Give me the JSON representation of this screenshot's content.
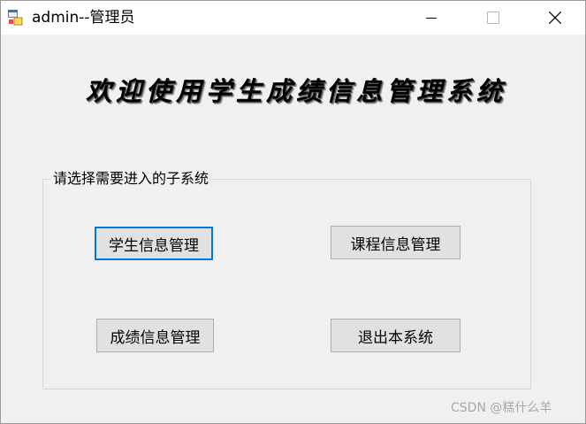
{
  "window": {
    "title": "admin--管理员",
    "icon": "windows-form-icon",
    "controls": {
      "minimize": "minimize-icon",
      "maximize": "maximize-icon",
      "close": "close-icon"
    }
  },
  "banner": {
    "text": "欢迎使用学生成绩信息管理系统"
  },
  "group": {
    "legend": "请选择需要进入的子系统",
    "buttons": {
      "student": "学生信息管理",
      "course": "课程信息管理",
      "score": "成绩信息管理",
      "exit": "退出本系统"
    }
  },
  "watermark": "CSDN @糕什么羊",
  "colors": {
    "focus_border": "#0078d7",
    "button_bg": "#e1e1e1",
    "form_bg": "#f0f0f0"
  }
}
